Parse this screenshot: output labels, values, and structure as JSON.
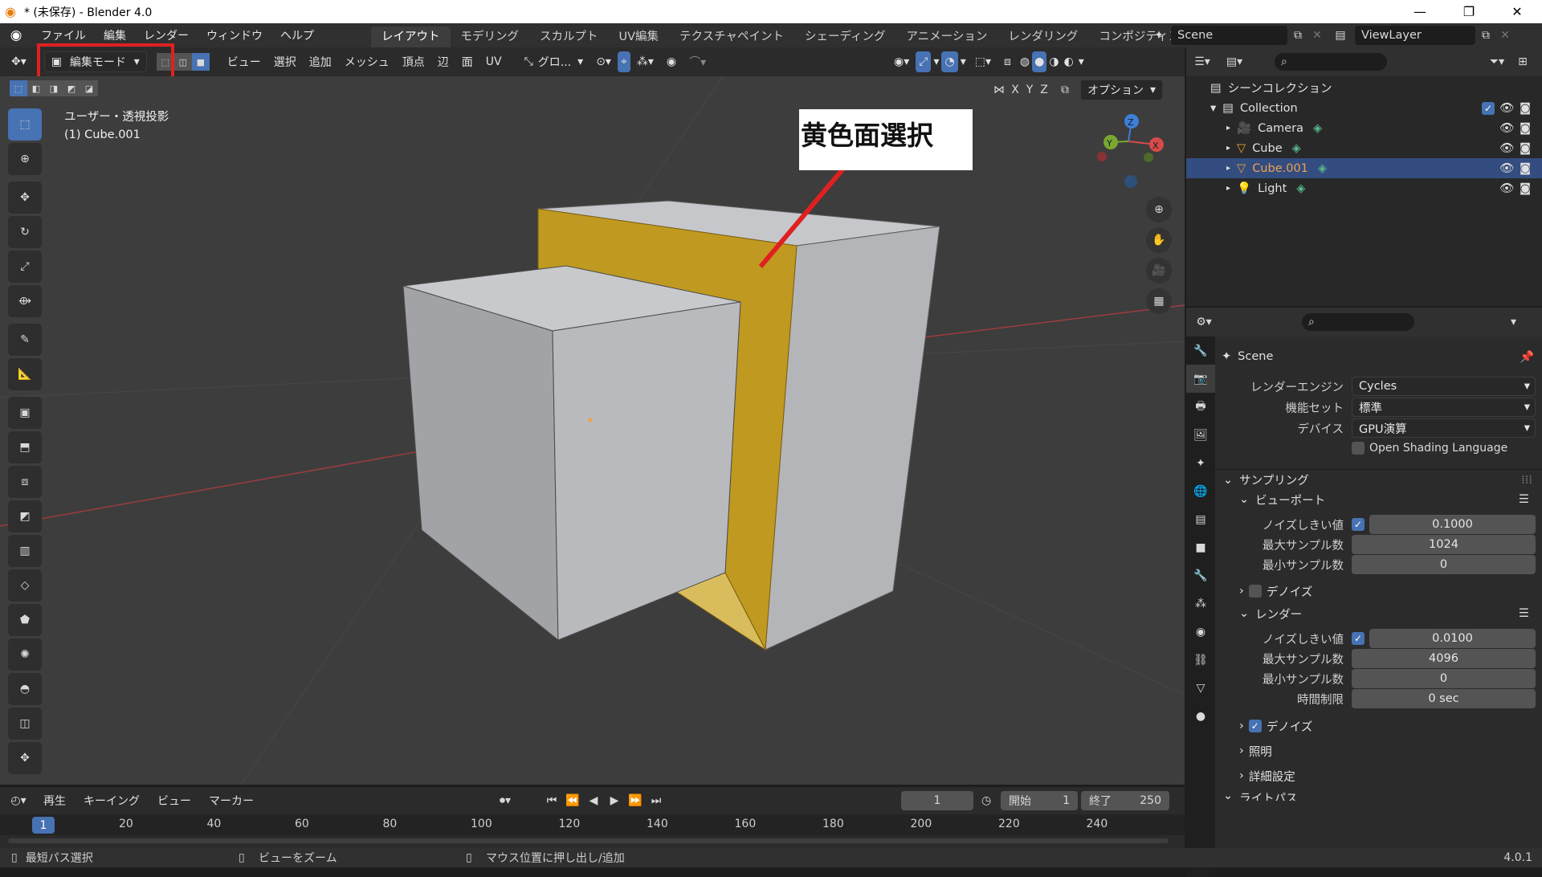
{
  "window": {
    "title": "* (未保存) - Blender 4.0",
    "min_glyph": "—",
    "max_glyph": "❐",
    "close_glyph": "✕"
  },
  "menubar": {
    "items": [
      "ファイル",
      "編集",
      "レンダー",
      "ウィンドウ",
      "ヘルプ"
    ]
  },
  "workspaces": {
    "tabs": [
      "レイアウト",
      "モデリング",
      "スカルプト",
      "UV編集",
      "テクスチャペイント",
      "シェーディング",
      "アニメーション",
      "レンダリング",
      "コンポジティング"
    ],
    "active": "レイアウト"
  },
  "scene_selector": {
    "value": "Scene"
  },
  "viewlayer_selector": {
    "value": "ViewLayer"
  },
  "viewport_header": {
    "mode": "編集モード",
    "menus": [
      "ビュー",
      "選択",
      "追加",
      "メッシュ",
      "頂点",
      "辺",
      "面",
      "UV"
    ],
    "transform_orientation": "グロ...",
    "axes": [
      "X",
      "Y",
      "Z"
    ],
    "options_label": "オプション"
  },
  "viewport": {
    "view_name": "ユーザー・透視投影",
    "object_name": "(1) Cube.001",
    "annotation": "黄色面選択",
    "gizmo_axes": {
      "x": "X",
      "y": "Y",
      "z": "Z"
    },
    "colors": {
      "background": "#3d3d3d",
      "selected_face": "#c09a20",
      "cube_face": "#b8b9bd",
      "annotation_line": "#e02020",
      "highlight_box": "#e02020"
    }
  },
  "outliner": {
    "root": "シーンコレクション",
    "collection": "Collection",
    "items": [
      {
        "name": "Camera",
        "icon": "camera-icon"
      },
      {
        "name": "Cube",
        "icon": "mesh-icon"
      },
      {
        "name": "Cube.001",
        "icon": "mesh-icon",
        "selected": true
      },
      {
        "name": "Light",
        "icon": "light-icon"
      }
    ]
  },
  "properties": {
    "context": "Scene",
    "render_engine_label": "レンダーエンジン",
    "render_engine": "Cycles",
    "feature_set_label": "機能セット",
    "feature_set": "標準",
    "device_label": "デバイス",
    "device": "GPU演算",
    "osl_label": "Open Shading Language",
    "sampling": "サンプリング",
    "viewport_section": "ビューポート",
    "noise_threshold_label": "ノイズしきい値",
    "viewport_noise_threshold": "0.1000",
    "max_samples_label": "最大サンプル数",
    "viewport_max_samples": "1024",
    "min_samples_label": "最小サンプル数",
    "viewport_min_samples": "0",
    "denoise_label": "デノイズ",
    "render_section": "レンダー",
    "render_noise_threshold": "0.0100",
    "render_max_samples": "4096",
    "render_min_samples": "0",
    "time_limit_label": "時間制限",
    "time_limit": "0 sec",
    "render_denoise_label": "デノイズ",
    "lighting_label": "照明",
    "advanced_label": "詳細設定",
    "cut_label": "ライトパス"
  },
  "timeline": {
    "menus": [
      "再生",
      "キーイング",
      "ビュー",
      "マーカー"
    ],
    "current_frame": "1",
    "start_label": "開始",
    "start": "1",
    "end_label": "終了",
    "end": "250",
    "ticks": [
      "20",
      "40",
      "60",
      "80",
      "100",
      "120",
      "140",
      "160",
      "180",
      "200",
      "220",
      "240"
    ],
    "playhead": "1"
  },
  "statusbar": {
    "left": "最短パス選択",
    "middle": "ビューをズーム",
    "right": "マウス位置に押し出し/追加",
    "version": "4.0.1"
  }
}
